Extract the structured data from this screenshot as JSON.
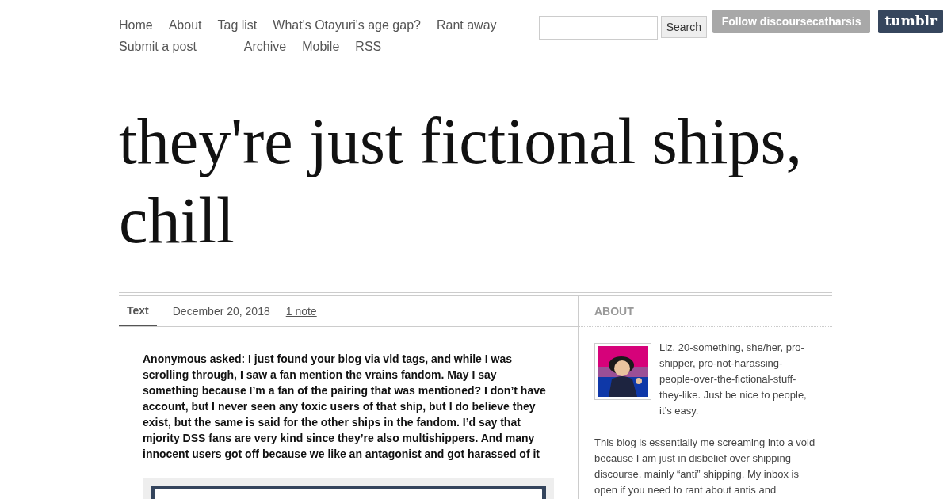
{
  "nav": {
    "links": [
      {
        "label": "Home"
      },
      {
        "label": "About"
      },
      {
        "label": "Tag list"
      },
      {
        "label": "What's Otayuri's age gap?"
      },
      {
        "label": "Rant away"
      },
      {
        "label": "Submit a post"
      },
      {
        "label": "Archive"
      },
      {
        "label": "Mobile"
      },
      {
        "label": "RSS"
      }
    ]
  },
  "search": {
    "button": "Search"
  },
  "tumblr_bar": {
    "follow": "Follow discoursecatharsis",
    "logo": "tumblr"
  },
  "blog_title": "they're just fictional ships, chill",
  "post": {
    "tabs": [
      {
        "label": "Text",
        "selected": true
      }
    ],
    "date": "December 20, 2018",
    "notes": "1 note",
    "question": "Anonymous asked: I just found your blog via vld tags, and while I was scrolling through, I saw a fan mention the vrains fandom. May I say something because I’m a fan of the pairing that was mentioned? I don’t have account, but I never seen any toxic users of that ship, but I do believe they exist, but the same is said for the other ships in the fandom. I’d say that mjority DSS fans are very kind since they’re also multishippers. And many innocent users got off because we like an antagonist and got harassed of it"
  },
  "sidebar": {
    "heading": "ABOUT",
    "bio": "Liz, 20-something, she/her, pro-shipper, pro-not-harassing-people-over-the-fictional-stuff-they-like. Just be nice to people, it’s easy.",
    "description": "This blog is essentially me screaming into a void because I am just in disbelief over shipping discourse, mainly “anti” shipping. My inbox is open if you need to rant about antis and"
  }
}
